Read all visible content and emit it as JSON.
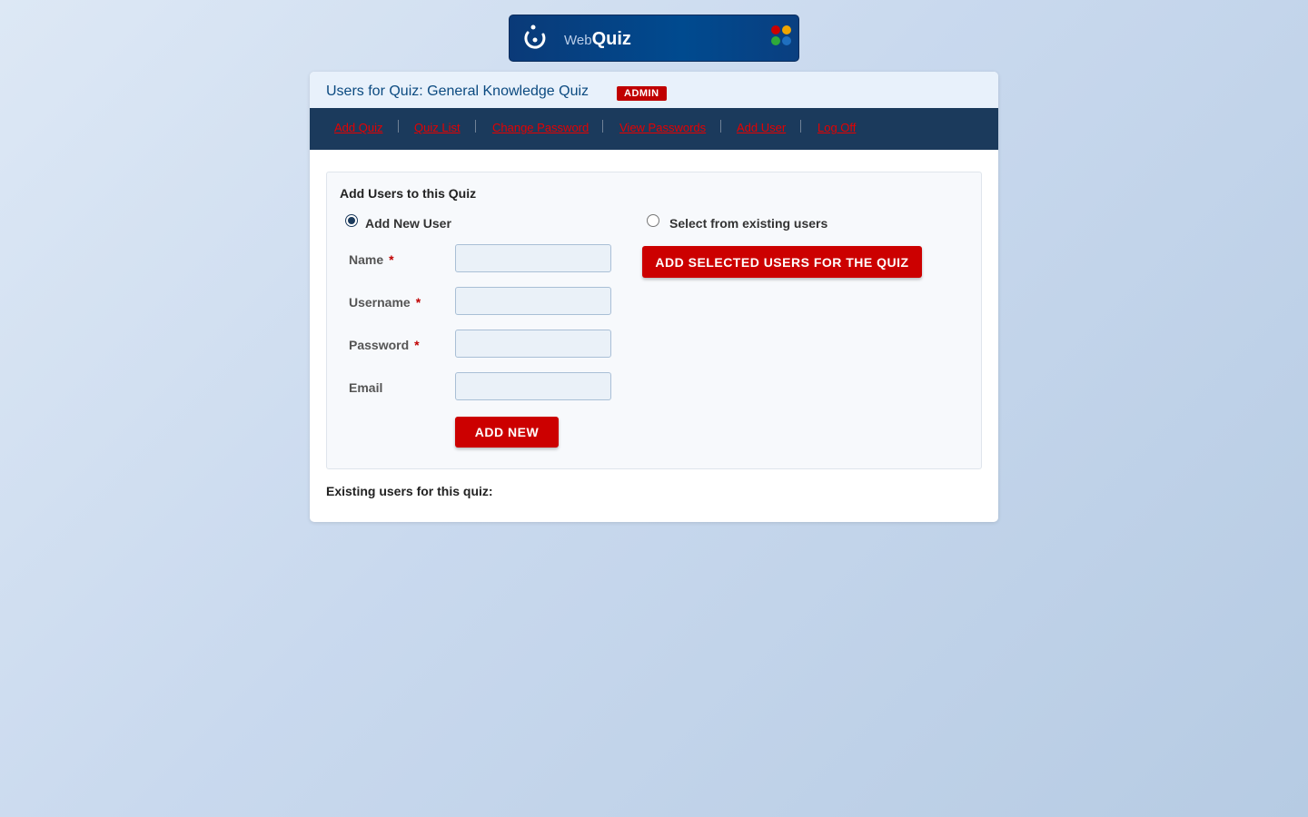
{
  "logo": {
    "web": "Web",
    "quiz": "Quiz",
    "dot_colors": [
      "#cc0000",
      "#f0a500",
      "#2eaa3a",
      "#1f6fbf"
    ]
  },
  "header": {
    "title": "Users for Quiz: General Knowledge Quiz",
    "badge": "ADMIN"
  },
  "nav": {
    "items": [
      "Add Quiz",
      "Quiz List",
      "Change Password",
      "View Passwords",
      "Add User",
      "Log Off"
    ]
  },
  "form": {
    "section_title": "Add Users to this Quiz",
    "option_new": "Add New User",
    "option_existing": "Select from existing users",
    "selected_option": "Add New User",
    "fields": {
      "name_label": "Name",
      "username_label": "Username",
      "password_label": "Password",
      "email_label": "Email",
      "required_mark": "*"
    },
    "values": {
      "name": "",
      "username": "",
      "password": "",
      "email": ""
    },
    "add_new_button": "ADD NEW",
    "add_selected_button": "ADD SELECTED USERS FOR THE QUIZ"
  },
  "existing_users": {
    "label": "Existing users for this quiz:"
  },
  "colors": {
    "accent_red": "#cc0000",
    "nav_bg": "#1b3a5c",
    "title_blue": "#0b4a80"
  }
}
